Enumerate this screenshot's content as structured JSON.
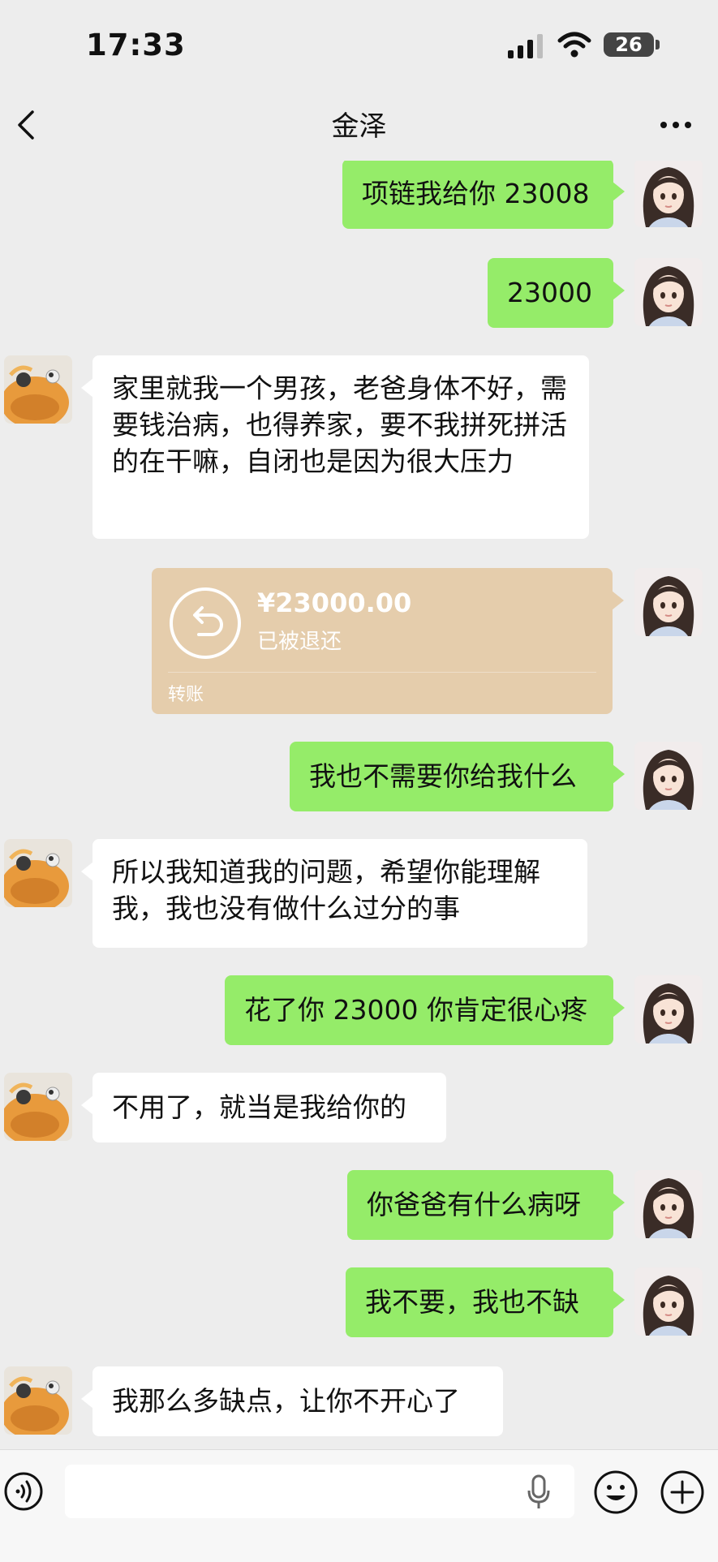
{
  "status_bar": {
    "time": "17:33",
    "battery": "26"
  },
  "header": {
    "title": "金泽"
  },
  "messages": [
    {
      "from": "me",
      "text": "项链我给你 23008"
    },
    {
      "from": "me",
      "text": "23000"
    },
    {
      "from": "other",
      "text": "家里就我一个男孩，老爸身体不好，需要钱治病，也得养家，要不我拼死拼活的在干嘛，自闭也是因为很大压力"
    },
    {
      "from": "me",
      "type": "transfer",
      "amount": "¥23000.00",
      "status": "已被退还",
      "label": "转账"
    },
    {
      "from": "me",
      "text": "我也不需要你给我什么"
    },
    {
      "from": "other",
      "text": "所以我知道我的问题，希望你能理解我，我也没有做什么过分的事"
    },
    {
      "from": "me",
      "text": "花了你 23000 你肯定很心疼"
    },
    {
      "from": "other",
      "text": "不用了，就当是我给你的"
    },
    {
      "from": "me",
      "text": "你爸爸有什么病呀"
    },
    {
      "from": "me",
      "text": "我不要，我也不缺"
    },
    {
      "from": "other",
      "text": "我那么多缺点，让你不开心了"
    }
  ],
  "colors": {
    "my_bubble": "#95ec69",
    "their_bubble": "#ffffff",
    "transfer_card": "#e5cdac",
    "background": "#ededed"
  },
  "icons": [
    "back-icon",
    "more-icon",
    "voice-icon",
    "mic-icon",
    "emoji-icon",
    "plus-icon",
    "return-arrow-icon"
  ]
}
